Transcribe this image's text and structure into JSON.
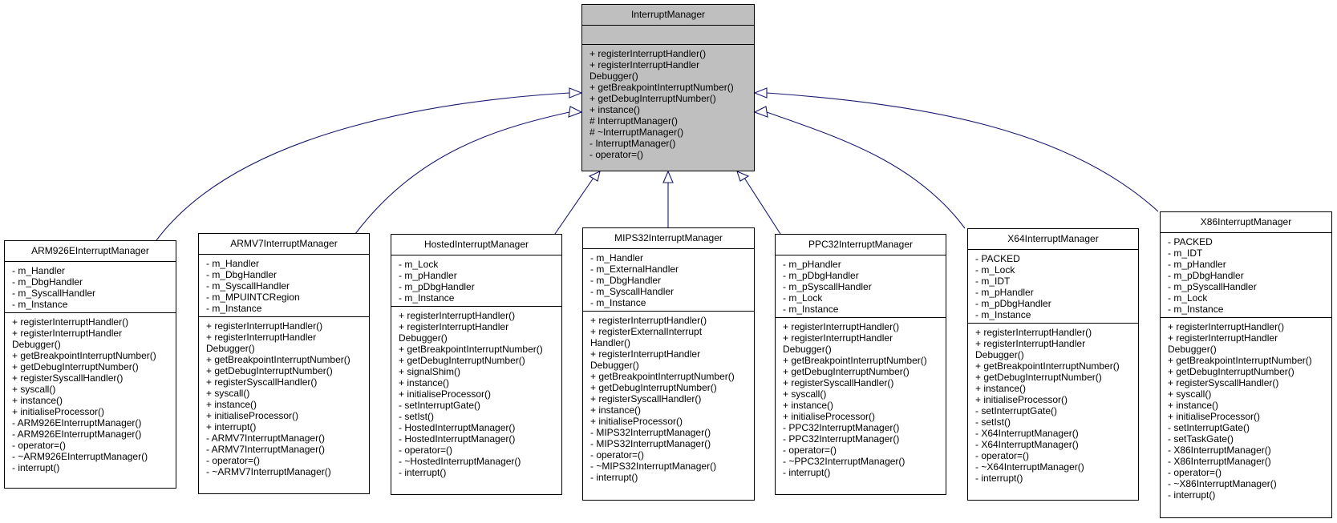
{
  "diagram": {
    "type": "class inheritance diagram",
    "base": {
      "name": "InterruptManager",
      "attributes": [],
      "operations": [
        "+ registerInterruptHandler()",
        "+ registerInterruptHandler",
        "Debugger()",
        "+ getBreakpointInterruptNumber()",
        "+ getDebugInterruptNumber()",
        "+ instance()",
        "# InterruptManager()",
        "# ~InterruptManager()",
        "- InterruptManager()",
        "- operator=()"
      ]
    },
    "derived": [
      {
        "name": "ARM926EInterruptManager",
        "attributes": [
          "- m_Handler",
          "- m_DbgHandler",
          "- m_SyscallHandler",
          "- m_Instance"
        ],
        "operations": [
          "+ registerInterruptHandler()",
          "+ registerInterruptHandler",
          "Debugger()",
          "+ getBreakpointInterruptNumber()",
          "+ getDebugInterruptNumber()",
          "+ registerSyscallHandler()",
          "+ syscall()",
          "+ instance()",
          "+ initialiseProcessor()",
          "- ARM926EInterruptManager()",
          "- ARM926EInterruptManager()",
          "- operator=()",
          "- ~ARM926EInterruptManager()",
          "- interrupt()"
        ]
      },
      {
        "name": "ARMV7InterruptManager",
        "attributes": [
          "- m_Handler",
          "- m_DbgHandler",
          "- m_SyscallHandler",
          "- m_MPUINTCRegion",
          "- m_Instance"
        ],
        "operations": [
          "+ registerInterruptHandler()",
          "+ registerInterruptHandler",
          "Debugger()",
          "+ getBreakpointInterruptNumber()",
          "+ getDebugInterruptNumber()",
          "+ registerSyscallHandler()",
          "+ syscall()",
          "+ instance()",
          "+ initialiseProcessor()",
          "+ interrupt()",
          "- ARMV7InterruptManager()",
          "- ARMV7InterruptManager()",
          "- operator=()",
          "- ~ARMV7InterruptManager()"
        ]
      },
      {
        "name": "HostedInterruptManager",
        "attributes": [
          "- m_Lock",
          "- m_pHandler",
          "- m_pDbgHandler",
          "- m_Instance"
        ],
        "operations": [
          "+ registerInterruptHandler()",
          "+ registerInterruptHandler",
          "Debugger()",
          "+ getBreakpointInterruptNumber()",
          "+ getDebugInterruptNumber()",
          "+ signalShim()",
          "+ instance()",
          "+ initialiseProcessor()",
          "- setInterruptGate()",
          "- setIst()",
          "- HostedInterruptManager()",
          "- HostedInterruptManager()",
          "- operator=()",
          "- ~HostedInterruptManager()",
          "- interrupt()"
        ]
      },
      {
        "name": "MIPS32InterruptManager",
        "attributes": [
          "- m_Handler",
          "- m_ExternalHandler",
          "- m_DbgHandler",
          "- m_SyscallHandler",
          "- m_Instance"
        ],
        "operations": [
          "+ registerInterruptHandler()",
          "+ registerExternalInterrupt",
          "Handler()",
          "+ registerInterruptHandler",
          "Debugger()",
          "+ getBreakpointInterruptNumber()",
          "+ getDebugInterruptNumber()",
          "+ registerSyscallHandler()",
          "+ instance()",
          "+ initialiseProcessor()",
          "- MIPS32InterruptManager()",
          "- MIPS32InterruptManager()",
          "- operator=()",
          "- ~MIPS32InterruptManager()",
          "- interrupt()"
        ]
      },
      {
        "name": "PPC32InterruptManager",
        "attributes": [
          "- m_pHandler",
          "- m_pDbgHandler",
          "- m_pSyscallHandler",
          "- m_Lock",
          "- m_Instance"
        ],
        "operations": [
          "+ registerInterruptHandler()",
          "+ registerInterruptHandler",
          "Debugger()",
          "+ getBreakpointInterruptNumber()",
          "+ getDebugInterruptNumber()",
          "+ registerSyscallHandler()",
          "+ syscall()",
          "+ instance()",
          "+ initialiseProcessor()",
          "- PPC32InterruptManager()",
          "- PPC32InterruptManager()",
          "- operator=()",
          "- ~PPC32InterruptManager()",
          "- interrupt()"
        ]
      },
      {
        "name": "X64InterruptManager",
        "attributes": [
          "- PACKED",
          "- m_Lock",
          "- m_IDT",
          "- m_pHandler",
          "- m_pDbgHandler",
          "- m_Instance"
        ],
        "operations": [
          "+ registerInterruptHandler()",
          "+ registerInterruptHandler",
          "Debugger()",
          "+ getBreakpointInterruptNumber()",
          "+ getDebugInterruptNumber()",
          "+ instance()",
          "+ initialiseProcessor()",
          "- setInterruptGate()",
          "- setIst()",
          "- X64InterruptManager()",
          "- X64InterruptManager()",
          "- operator=()",
          "- ~X64InterruptManager()",
          "- interrupt()"
        ]
      },
      {
        "name": "X86InterruptManager",
        "attributes": [
          "- PACKED",
          "- m_IDT",
          "- m_pHandler",
          "- m_pDbgHandler",
          "- m_pSyscallHandler",
          "- m_Lock",
          "- m_Instance"
        ],
        "operations": [
          "+ registerInterruptHandler()",
          "+ registerInterruptHandler",
          "Debugger()",
          "+ getBreakpointInterruptNumber()",
          "+ getDebugInterruptNumber()",
          "+ registerSyscallHandler()",
          "+ syscall()",
          "+ instance()",
          "+ initialiseProcessor()",
          "- setInterruptGate()",
          "- setTaskGate()",
          "- X86InterruptManager()",
          "- X86InterruptManager()",
          "- operator=()",
          "- ~X86InterruptManager()",
          "- interrupt()"
        ]
      }
    ],
    "colors": {
      "base_fill": "#bfbfbf",
      "class_fill": "#ffffff",
      "edge": "#191970"
    }
  }
}
